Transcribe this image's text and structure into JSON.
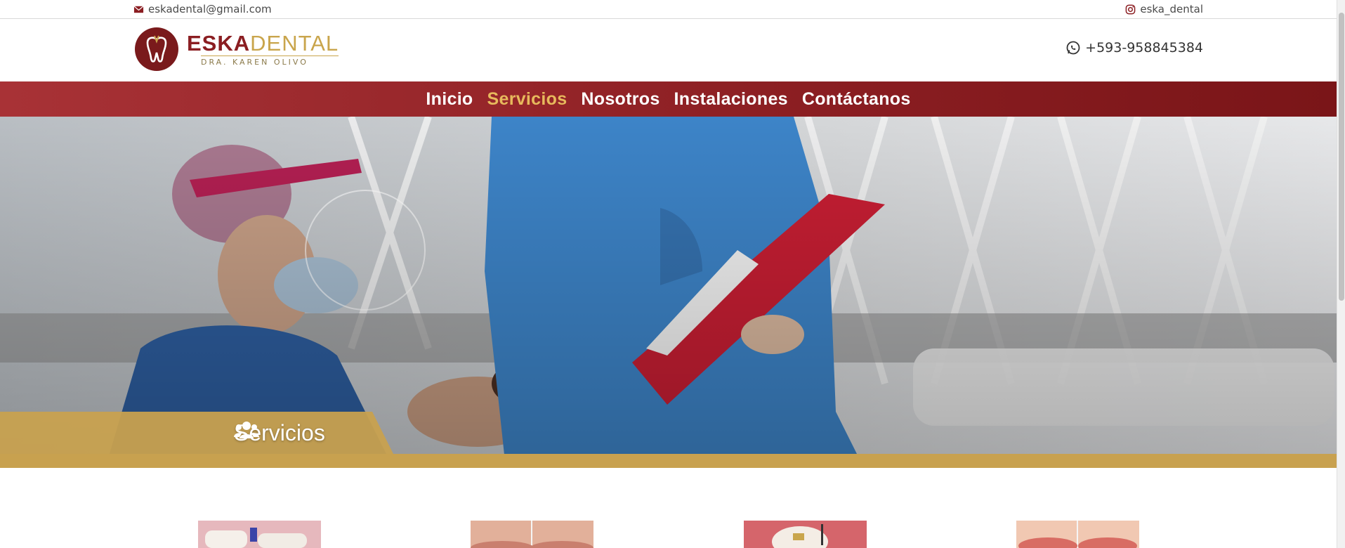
{
  "topbar": {
    "email": "eskadental@gmail.com",
    "instagram": "eska_dental"
  },
  "header": {
    "logo_primary": "ESKA",
    "logo_secondary": "DENTAL",
    "logo_subtitle": "DRA. KAREN OLIVO",
    "phone": "+593-958845384"
  },
  "nav": {
    "items": [
      {
        "label": "Inicio",
        "active": false
      },
      {
        "label": "Servicios",
        "active": true
      },
      {
        "label": "Nosotros",
        "active": false
      },
      {
        "label": "Instalaciones",
        "active": false
      },
      {
        "label": "Contáctanos",
        "active": false
      }
    ]
  },
  "hero": {
    "title": "Servicios",
    "icon": "users-icon"
  },
  "services": {
    "thumbnails": [
      "dental-tooth-image",
      "lips-comparison-image",
      "tooth-model-image",
      "smile-comparison-image"
    ]
  },
  "colors": {
    "brand_red": "#8b1e22",
    "brand_gold": "#c8a14f",
    "nav_active": "#e7b95c"
  }
}
